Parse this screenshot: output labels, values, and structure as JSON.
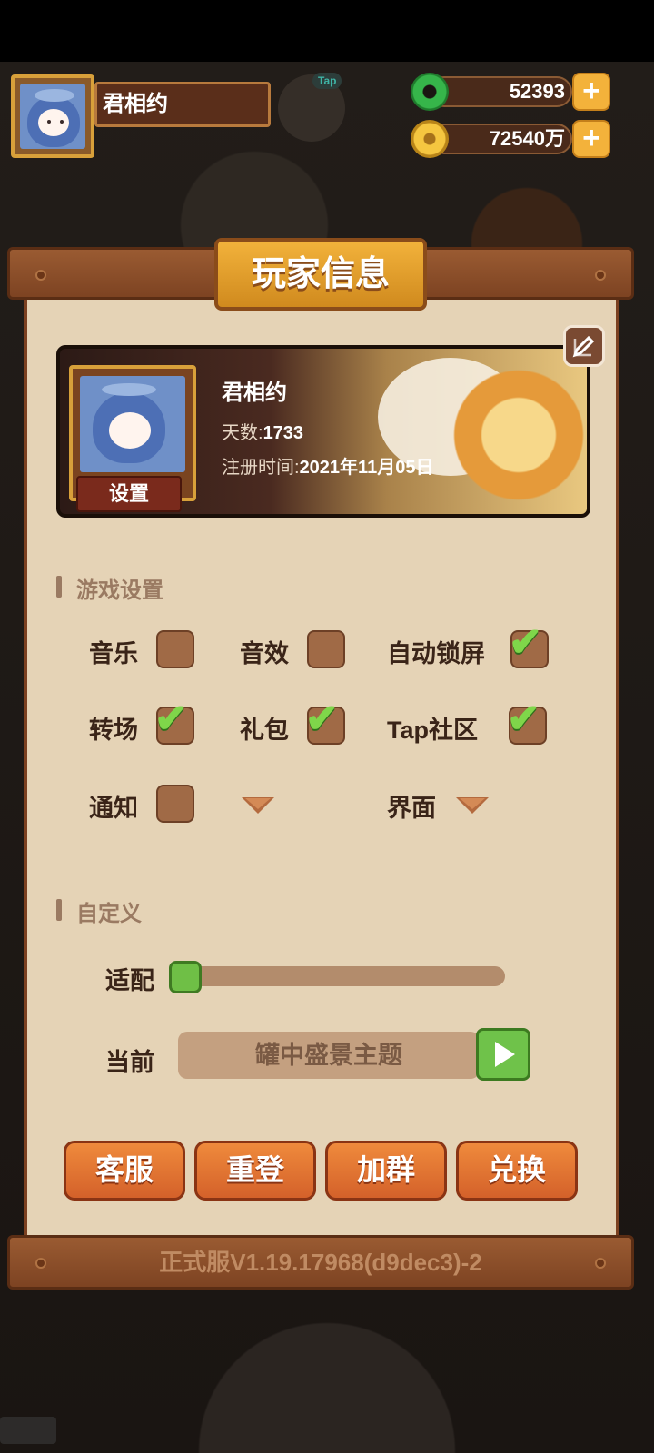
{
  "player": {
    "name": "君相约"
  },
  "tap_tag": "Tap",
  "currencies": [
    {
      "icon": "jade-icon",
      "value": "52393"
    },
    {
      "icon": "coin-icon",
      "value": "72540万"
    }
  ],
  "plus_label": "+",
  "panel": {
    "title": "玩家信息",
    "card": {
      "name": "君相约",
      "days_label": "天数:",
      "days_value": "1733",
      "reg_label": "注册时间:",
      "reg_value": "2021年11月05日",
      "settings_label": "设置"
    },
    "game_settings": {
      "title": "游戏设置",
      "options": [
        {
          "label": "音乐",
          "checked": false
        },
        {
          "label": "音效",
          "checked": false
        },
        {
          "label": "自动锁屏",
          "checked": true
        },
        {
          "label": "转场",
          "checked": true
        },
        {
          "label": "礼包",
          "checked": true
        },
        {
          "label": "Tap社区",
          "checked": true
        },
        {
          "label": "通知",
          "checked": false
        },
        {
          "label": "界面",
          "checked": null
        }
      ],
      "check_glyph": "✔"
    },
    "custom": {
      "title": "自定义",
      "fit_label": "适配",
      "fit_level": 0,
      "current_label": "当前",
      "current_theme": "罐中盛景主题"
    },
    "buttons": [
      "客服",
      "重登",
      "加群",
      "兑换"
    ],
    "version": "正式服V1.19.17968(d9dec3)-2"
  }
}
